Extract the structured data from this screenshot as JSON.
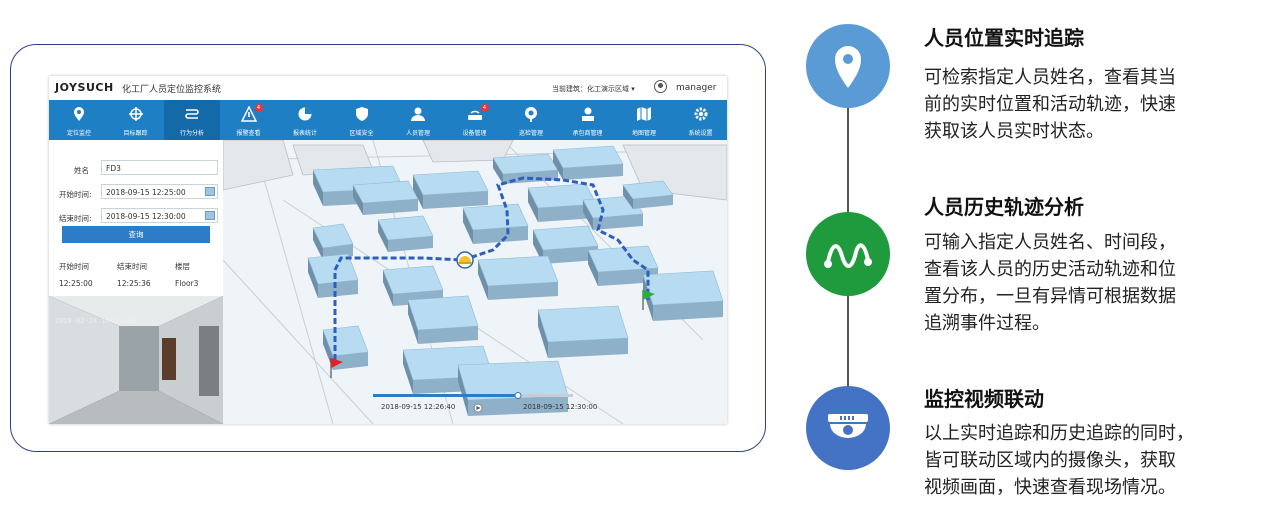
{
  "app": {
    "brand": "JOYSUCH",
    "system_name": "化工厂人员定位监控系统",
    "current_building": "当前建筑：化工演示区域 ▾",
    "username": "manager"
  },
  "nav": [
    {
      "label": "定位监控",
      "icon": "location-pin-icon"
    },
    {
      "label": "目标跟踪",
      "icon": "crosshair-icon"
    },
    {
      "label": "行为分析",
      "icon": "path-icon",
      "active": true
    },
    {
      "label": "报警查看",
      "icon": "warning-icon",
      "badge": "4"
    },
    {
      "label": "报表统计",
      "icon": "pie-chart-icon"
    },
    {
      "label": "区域安全",
      "icon": "shield-icon"
    },
    {
      "label": "人员管理",
      "icon": "person-icon"
    },
    {
      "label": "设备管理",
      "icon": "router-icon",
      "badge": "4"
    },
    {
      "label": "巡检管理",
      "icon": "patrol-icon"
    },
    {
      "label": "承包商管理",
      "icon": "contractor-icon"
    },
    {
      "label": "地图管理",
      "icon": "map-icon"
    },
    {
      "label": "系统设置",
      "icon": "gear-icon"
    }
  ],
  "search": {
    "name_label": "姓名",
    "name_value": "FD3",
    "start_label": "开始时间:",
    "start_value": "2018-09-15 12:25:00",
    "end_label": "结束时间:",
    "end_value": "2018-09-15 12:30:00",
    "query_button": "查询"
  },
  "result_table": {
    "headers": [
      "开始时间",
      "结束时间",
      "楼层"
    ],
    "rows": [
      [
        "12:25:00",
        "12:25:36",
        "Floor3"
      ]
    ]
  },
  "video": {
    "timestamp": "2018-02-24 16:45:10"
  },
  "playback": {
    "start_time": "2018-09-15 12:26:40",
    "end_time": "2018-09-15 12:30:00"
  },
  "features": [
    {
      "title": "人员位置实时追踪",
      "lines": [
        "可检索指定人员姓名，查看其当",
        "前的实时位置和活动轨迹，快速",
        "获取该人员实时状态。"
      ],
      "icon": "location-pin-icon",
      "color": "#5b9bd5"
    },
    {
      "title": "人员历史轨迹分析",
      "lines": [
        "可输入指定人员姓名、时间段，",
        "查看该人员的历史活动轨迹和位",
        "置分布，一旦有异情可根据数据",
        "追溯事件过程。"
      ],
      "icon": "trajectory-icon",
      "color": "#1f9a3c"
    },
    {
      "title": "监控视频联动",
      "lines": [
        "以上实时追踪和历史追踪的同时，",
        "皆可联动区域内的摄像头，获取",
        "视频画面，快速查看现场情况。"
      ],
      "icon": "dome-camera-icon",
      "color": "#4472c4"
    }
  ],
  "colors": {
    "nav_blue": "#1f7fc4",
    "accent": "#2e7cc5",
    "frame": "#2f3f86",
    "track": "#2e5fbf"
  }
}
